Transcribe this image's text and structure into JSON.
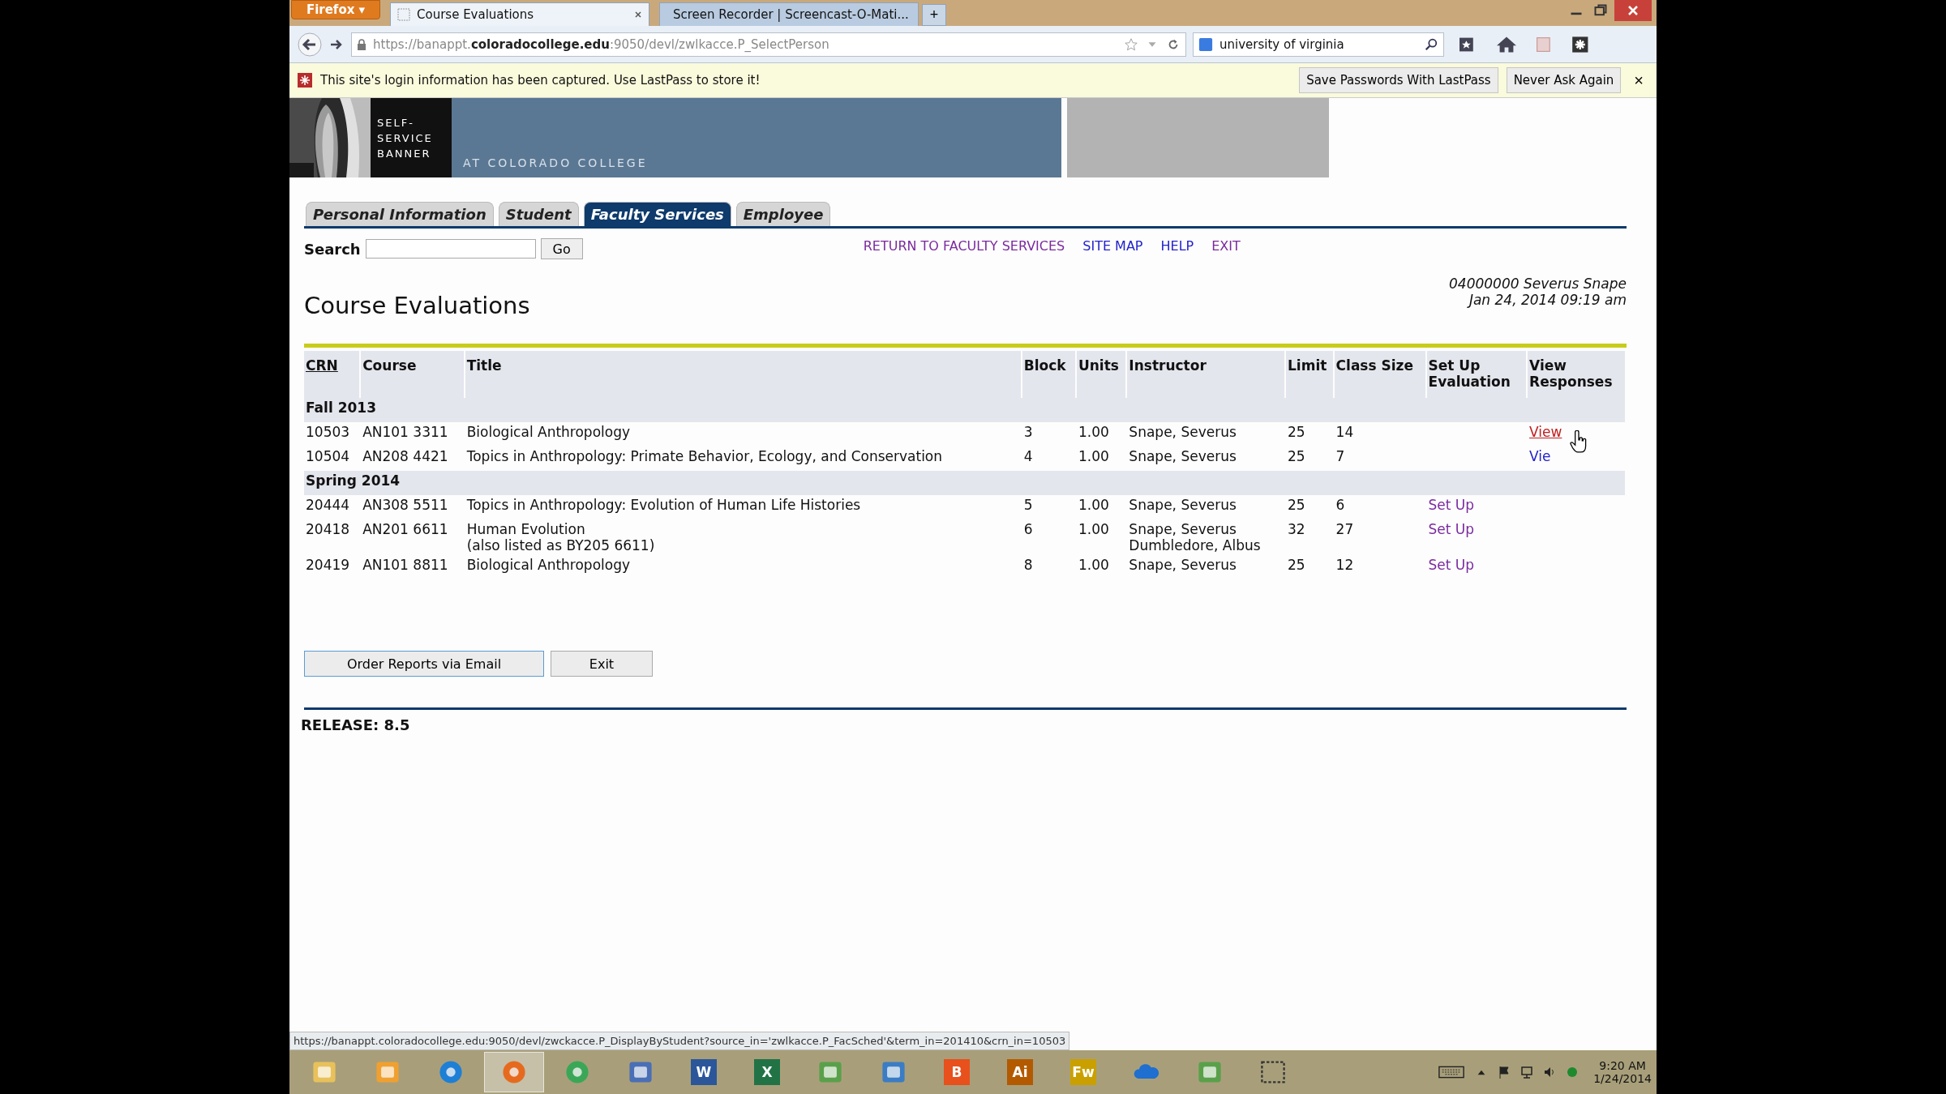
{
  "browser": {
    "menu_button": "Firefox ▾",
    "tabs": [
      {
        "title": "Course Evaluations",
        "selected": true
      },
      {
        "title": "Screen Recorder | Screencast-O-Mati...",
        "selected": false
      }
    ],
    "new_tab": "+",
    "url": "https://banappt.**coloradocollege.edu**:9050/devl/zwlkacce.P_SelectPerson",
    "search": "university of virginia"
  },
  "notification": {
    "text": "This site's login information has been captured. Use LastPass to store it!",
    "buttons": [
      "Save Passwords With LastPass",
      "Never Ask Again"
    ],
    "close": "×"
  },
  "banner": {
    "logo_lines": [
      "SELF-",
      "SERVICE",
      "BANNER"
    ],
    "tagline": "AT COLORADO COLLEGE"
  },
  "tabs": [
    {
      "label": "Personal Information",
      "selected": false
    },
    {
      "label": "Student",
      "selected": false
    },
    {
      "label": "Faculty Services",
      "selected": true
    },
    {
      "label": "Employee",
      "selected": false
    }
  ],
  "search": {
    "label": "Search",
    "button": "Go"
  },
  "links": [
    {
      "text": "RETURN TO FACULTY SERVICES",
      "visited": true
    },
    {
      "text": "SITE MAP",
      "visited": false
    },
    {
      "text": "HELP",
      "visited": false
    },
    {
      "text": "EXIT",
      "visited": true
    }
  ],
  "user": {
    "id_name": "04000000 Severus Snape",
    "datetime": "Jan 24, 2014 09:19 am"
  },
  "title": "Course Evaluations",
  "table": {
    "columns": [
      {
        "lines": [
          "CRN"
        ],
        "link": true
      },
      {
        "lines": [
          "Course"
        ],
        "link": false
      },
      {
        "lines": [
          "Title"
        ],
        "link": false
      },
      {
        "lines": [
          "Block"
        ],
        "link": false
      },
      {
        "lines": [
          "Units"
        ],
        "link": false
      },
      {
        "lines": [
          "Instructor"
        ],
        "link": false
      },
      {
        "lines": [
          "Limit"
        ],
        "link": false
      },
      {
        "lines": [
          "Class Size"
        ],
        "link": false
      },
      {
        "lines": [
          "Set Up",
          "Evaluation"
        ],
        "link": false
      },
      {
        "lines": [
          "View",
          "Responses"
        ],
        "link": false
      }
    ],
    "groups": [
      {
        "term": "Fall 2013",
        "rows": [
          {
            "crn": "10503",
            "course": "AN101 3311",
            "title": "Biological Anthropology",
            "block": "3",
            "units": "1.00",
            "instructors": [
              "Snape, Severus"
            ],
            "limit": "25",
            "class_size": "14",
            "view": {
              "text": "View",
              "visited": false,
              "hovered": true
            }
          },
          {
            "crn": "10504",
            "course": "AN208 4421",
            "title": "Topics in Anthropology: Primate Behavior, Ecology, and Conservation",
            "block": "4",
            "units": "1.00",
            "instructors": [
              "Snape, Severus"
            ],
            "limit": "25",
            "class_size": "7",
            "view": {
              "text": "Vie",
              "visited": false,
              "hovered": false
            }
          }
        ]
      },
      {
        "term": "Spring 2014",
        "rows": [
          {
            "crn": "20444",
            "course": "AN308 5511",
            "title": "Topics in Anthropology: Evolution of Human Life Histories",
            "block": "5",
            "units": "1.00",
            "instructors": [
              "Snape, Severus"
            ],
            "limit": "25",
            "class_size": "6",
            "set_up": {
              "text": "Set Up",
              "visited": true,
              "hovered": false
            }
          },
          {
            "crn": "20418",
            "course": "AN201 6611",
            "title": "Human Evolution",
            "title_note": "(also listed as BY205 6611)",
            "block": "6",
            "units": "1.00",
            "instructors": [
              "Snape, Severus",
              "Dumbledore, Albus"
            ],
            "limit": "32",
            "class_size": "27",
            "set_up": {
              "text": "Set Up",
              "visited": true,
              "hovered": false
            }
          },
          {
            "crn": "20419",
            "course": "AN101 8811",
            "title": "Biological Anthropology",
            "block": "8",
            "units": "1.00",
            "instructors": [
              "Snape, Severus"
            ],
            "limit": "25",
            "class_size": "12",
            "set_up": {
              "text": "Set Up",
              "visited": true,
              "hovered": false
            }
          }
        ]
      }
    ]
  },
  "buttons": [
    "Order Reports via Email",
    "Exit"
  ],
  "release": "RELEASE: 8.5",
  "status_url": "https://banappt.coloradocollege.edu:9050/devl/zwckacce.P_DisplayByStudent?source_in='zwlkacce.P_FacSched'&term_in=201410&crn_in=10503",
  "taskbar": {
    "apps": [
      {
        "kind": "folder",
        "selected": false
      },
      {
        "kind": "mail",
        "selected": false
      },
      {
        "kind": "globe",
        "selected": false
      },
      {
        "kind": "fox",
        "selected": true
      },
      {
        "kind": "wheel",
        "selected": false
      },
      {
        "kind": "monitor",
        "selected": false
      },
      {
        "kind": "letter",
        "label": "W",
        "selected": false
      },
      {
        "kind": "letter",
        "label": "X",
        "selected": false
      },
      {
        "kind": "note",
        "selected": false
      },
      {
        "kind": "chart",
        "selected": false
      },
      {
        "kind": "letter",
        "label": "B",
        "selected": false
      },
      {
        "kind": "letter",
        "label": "Ai",
        "selected": false
      },
      {
        "kind": "letter",
        "label": "Fw",
        "selected": false
      },
      {
        "kind": "cloud",
        "selected": false
      },
      {
        "kind": "note",
        "selected": false
      },
      {
        "kind": "snip",
        "selected": false
      }
    ],
    "clock": {
      "time": "9:20 AM",
      "date": "1/24/2014"
    }
  }
}
